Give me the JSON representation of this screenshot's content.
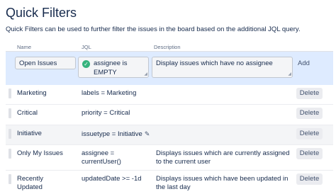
{
  "page": {
    "title": "Quick Filters",
    "description": "Quick Filters can be used to further filter the issues in the board based on the additional JQL query."
  },
  "columns": {
    "name": "Name",
    "jql": "JQL",
    "description": "Description"
  },
  "new_filter": {
    "name": "Open Issues",
    "jql": "assignee is EMPTY",
    "description": "Display issues which have no assignee",
    "add_label": "Add",
    "valid_icon": "check-circle-icon"
  },
  "filters": [
    {
      "name": "Marketing",
      "jql": "labels = Marketing",
      "description": "",
      "delete_label": "Delete"
    },
    {
      "name": "Critical",
      "jql": "priority = Critical",
      "description": "",
      "delete_label": "Delete"
    },
    {
      "name": "Initiative",
      "jql": "issuetype = Initiative",
      "description": "",
      "delete_label": "Delete",
      "editing": true
    },
    {
      "name": "Only My Issues",
      "jql": "assignee =\ncurrentUser()",
      "description": "Displays issues which are currently assigned\nto the current user",
      "delete_label": "Delete"
    },
    {
      "name": "Recently\nUpdated",
      "jql": "updatedDate >= -1d",
      "description": "Displays issues which have been updated in\nthe last day",
      "delete_label": "Delete"
    }
  ]
}
